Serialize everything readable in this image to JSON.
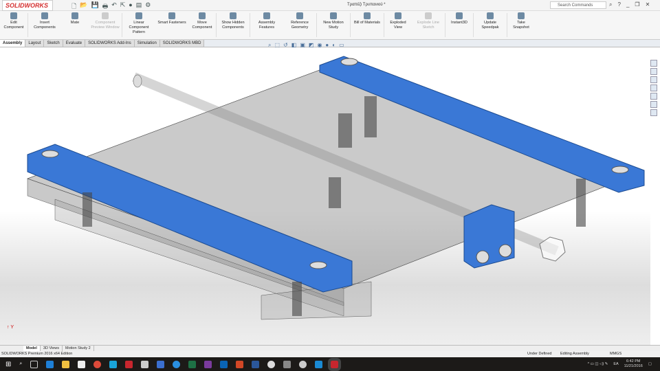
{
  "app": {
    "brand": "SOLIDWORKS",
    "title": "Τραπέζι Τρυπανιού *",
    "search_placeholder": "Search Commands",
    "help": "?"
  },
  "ribbon": [
    {
      "label": "Edit Component",
      "icon": "edit-component-icon",
      "enabled": true
    },
    {
      "label": "Insert Components",
      "icon": "insert-components-icon",
      "enabled": true
    },
    {
      "label": "Mate",
      "icon": "mate-icon",
      "enabled": true
    },
    {
      "label": "Component Preview Window",
      "icon": "preview-window-icon",
      "enabled": false
    },
    {
      "label": "Linear Component Pattern",
      "icon": "pattern-icon",
      "enabled": true
    },
    {
      "label": "Smart Fasteners",
      "icon": "fasteners-icon",
      "enabled": true
    },
    {
      "label": "Move Component",
      "icon": "move-icon",
      "enabled": true
    },
    {
      "label": "Show Hidden Components",
      "icon": "show-hidden-icon",
      "enabled": true
    },
    {
      "label": "Assembly Features",
      "icon": "assembly-features-icon",
      "enabled": true
    },
    {
      "label": "Reference Geometry",
      "icon": "reference-geometry-icon",
      "enabled": true
    },
    {
      "label": "New Motion Study",
      "icon": "motion-study-icon",
      "enabled": true
    },
    {
      "label": "Bill of Materials",
      "icon": "bom-icon",
      "enabled": true
    },
    {
      "label": "Exploded View",
      "icon": "exploded-view-icon",
      "enabled": true
    },
    {
      "label": "Explode Line Sketch",
      "icon": "explode-line-icon",
      "enabled": false
    },
    {
      "label": "Instant3D",
      "icon": "instant3d-icon",
      "enabled": true
    },
    {
      "label": "Update Speedpak",
      "icon": "speedpak-icon",
      "enabled": true
    },
    {
      "label": "Take Snapshot",
      "icon": "snapshot-icon",
      "enabled": true
    }
  ],
  "tabs": [
    "Assembly",
    "Layout",
    "Sketch",
    "Evaluate",
    "SOLIDWORKS Add-Ins",
    "Simulation",
    "SOLIDWORKS MBD"
  ],
  "bottom_tabs": [
    "Model",
    "3D Views",
    "Motion Study 2"
  ],
  "status": {
    "edition": "SOLIDWORKS Premium 2016 x64 Edition",
    "state": "Under Defined",
    "mode": "Editing Assembly",
    "units": "MMGS"
  },
  "tray": {
    "lang": "EA",
    "time": "6:42 PM",
    "date": "11/21/2016"
  },
  "colors": {
    "accent": "#3a78d6",
    "brand": "#d42e2e"
  }
}
